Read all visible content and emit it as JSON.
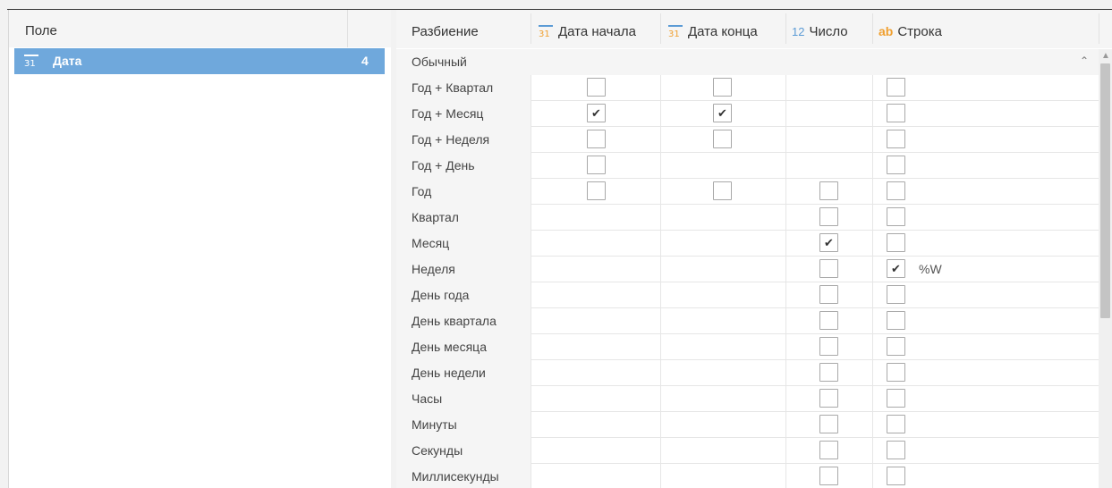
{
  "left": {
    "header": "Поле",
    "field": {
      "icon": "calendar-icon",
      "name": "Дата",
      "count": "4"
    }
  },
  "right": {
    "columns": {
      "split": "Разбиение",
      "date_start": "Дата начала",
      "date_end": "Дата конца",
      "number": "Число",
      "string": "Строка"
    },
    "icons": {
      "calendar_digits": "31",
      "number": "12",
      "string": "ab"
    },
    "group": "Обычный",
    "rows": [
      {
        "label": "Год + Квартал",
        "c1": 0,
        "c2": 0,
        "c3": -1,
        "c4": 0,
        "fmt": ""
      },
      {
        "label": "Год + Месяц",
        "c1": 1,
        "c2": 1,
        "c3": -1,
        "c4": 0,
        "fmt": ""
      },
      {
        "label": "Год + Неделя",
        "c1": 0,
        "c2": 0,
        "c3": -1,
        "c4": 0,
        "fmt": ""
      },
      {
        "label": "Год + День",
        "c1": 0,
        "c2": -1,
        "c3": -1,
        "c4": 0,
        "fmt": ""
      },
      {
        "label": "Год",
        "c1": 0,
        "c2": 0,
        "c3": 0,
        "c4": 0,
        "fmt": ""
      },
      {
        "label": "Квартал",
        "c1": -1,
        "c2": -1,
        "c3": 0,
        "c4": 0,
        "fmt": ""
      },
      {
        "label": "Месяц",
        "c1": -1,
        "c2": -1,
        "c3": 1,
        "c4": 0,
        "fmt": ""
      },
      {
        "label": "Неделя",
        "c1": -1,
        "c2": -1,
        "c3": 0,
        "c4": 1,
        "fmt": "%W"
      },
      {
        "label": "День года",
        "c1": -1,
        "c2": -1,
        "c3": 0,
        "c4": 0,
        "fmt": ""
      },
      {
        "label": "День квартала",
        "c1": -1,
        "c2": -1,
        "c3": 0,
        "c4": 0,
        "fmt": ""
      },
      {
        "label": "День месяца",
        "c1": -1,
        "c2": -1,
        "c3": 0,
        "c4": 0,
        "fmt": ""
      },
      {
        "label": "День недели",
        "c1": -1,
        "c2": -1,
        "c3": 0,
        "c4": 0,
        "fmt": ""
      },
      {
        "label": "Часы",
        "c1": -1,
        "c2": -1,
        "c3": 0,
        "c4": 0,
        "fmt": ""
      },
      {
        "label": "Минуты",
        "c1": -1,
        "c2": -1,
        "c3": 0,
        "c4": 0,
        "fmt": ""
      },
      {
        "label": "Секунды",
        "c1": -1,
        "c2": -1,
        "c3": 0,
        "c4": 0,
        "fmt": ""
      },
      {
        "label": "Миллисекунды",
        "c1": -1,
        "c2": -1,
        "c3": 0,
        "c4": 0,
        "fmt": ""
      }
    ]
  },
  "colors": {
    "selection": "#6fa8dc",
    "calendar_accent": "#f0a030",
    "calendar_bar": "#5b9bd5",
    "number_icon": "#5b9bd5",
    "string_icon": "#f0a030"
  }
}
